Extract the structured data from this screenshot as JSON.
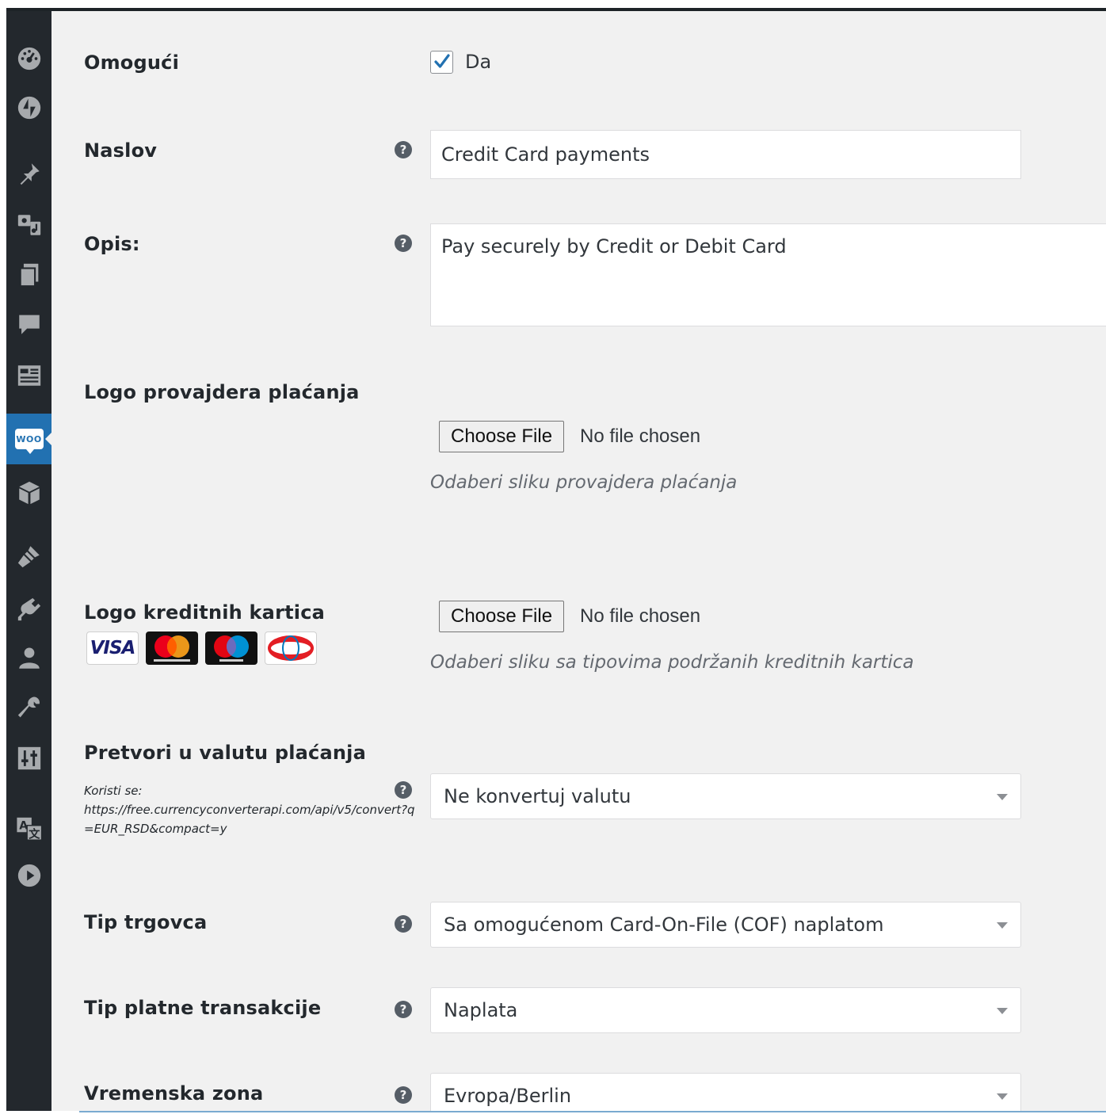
{
  "sidebar": {
    "items": [
      {
        "icon": "dashboard-icon"
      },
      {
        "icon": "jetpack-icon"
      },
      {
        "icon": "posts-pin-icon"
      },
      {
        "icon": "media-icon"
      },
      {
        "icon": "pages-icon"
      },
      {
        "icon": "comments-icon"
      },
      {
        "icon": "forms-icon"
      },
      {
        "icon": "woocommerce-icon",
        "label": "WOO",
        "active": true
      },
      {
        "icon": "products-box-icon"
      },
      {
        "icon": "appearance-brush-icon"
      },
      {
        "icon": "plugins-icon"
      },
      {
        "icon": "users-icon"
      },
      {
        "icon": "tools-wrench-icon"
      },
      {
        "icon": "settings-sliders-icon"
      },
      {
        "icon": "translate-icon"
      },
      {
        "icon": "play-circle-icon"
      }
    ],
    "accent_color": "#2271b1",
    "background_color": "#23282d"
  },
  "form": {
    "enable": {
      "label": "Omogući",
      "checkbox_label": "Da",
      "checked": true
    },
    "title": {
      "label": "Naslov",
      "value": "Credit Card payments"
    },
    "description": {
      "label": "Opis:",
      "value": "Pay securely by Credit or Debit Card"
    },
    "provider_logo": {
      "label": "Logo provajdera plaćanja",
      "button": "Choose File",
      "status": "No file chosen",
      "hint": "Odaberi sliku provajdera plaćanja"
    },
    "card_logo": {
      "label": "Logo kreditnih kartica",
      "button": "Choose File",
      "status": "No file chosen",
      "hint": "Odaberi sliku sa tipovima podržanih kreditnih kartica",
      "cards": [
        "VISA",
        "mastercard",
        "maestro",
        "DinersClub"
      ]
    },
    "currency": {
      "label": "Pretvori u valutu plaćanja",
      "note_prefix": "Koristi se:",
      "note_url": "https://free.currencyconverterapi.com/api/v5/convert?q=EUR_RSD&compact=y",
      "value": "Ne konvertuj valutu"
    },
    "merchant_type": {
      "label": "Tip trgovca",
      "value": "Sa omogućenom Card-On-File (COF) naplatom"
    },
    "transaction_type": {
      "label": "Tip platne transakcije",
      "value": "Naplata"
    },
    "timezone": {
      "label": "Vremenska zona",
      "value": "Evropa/Berlin"
    }
  }
}
